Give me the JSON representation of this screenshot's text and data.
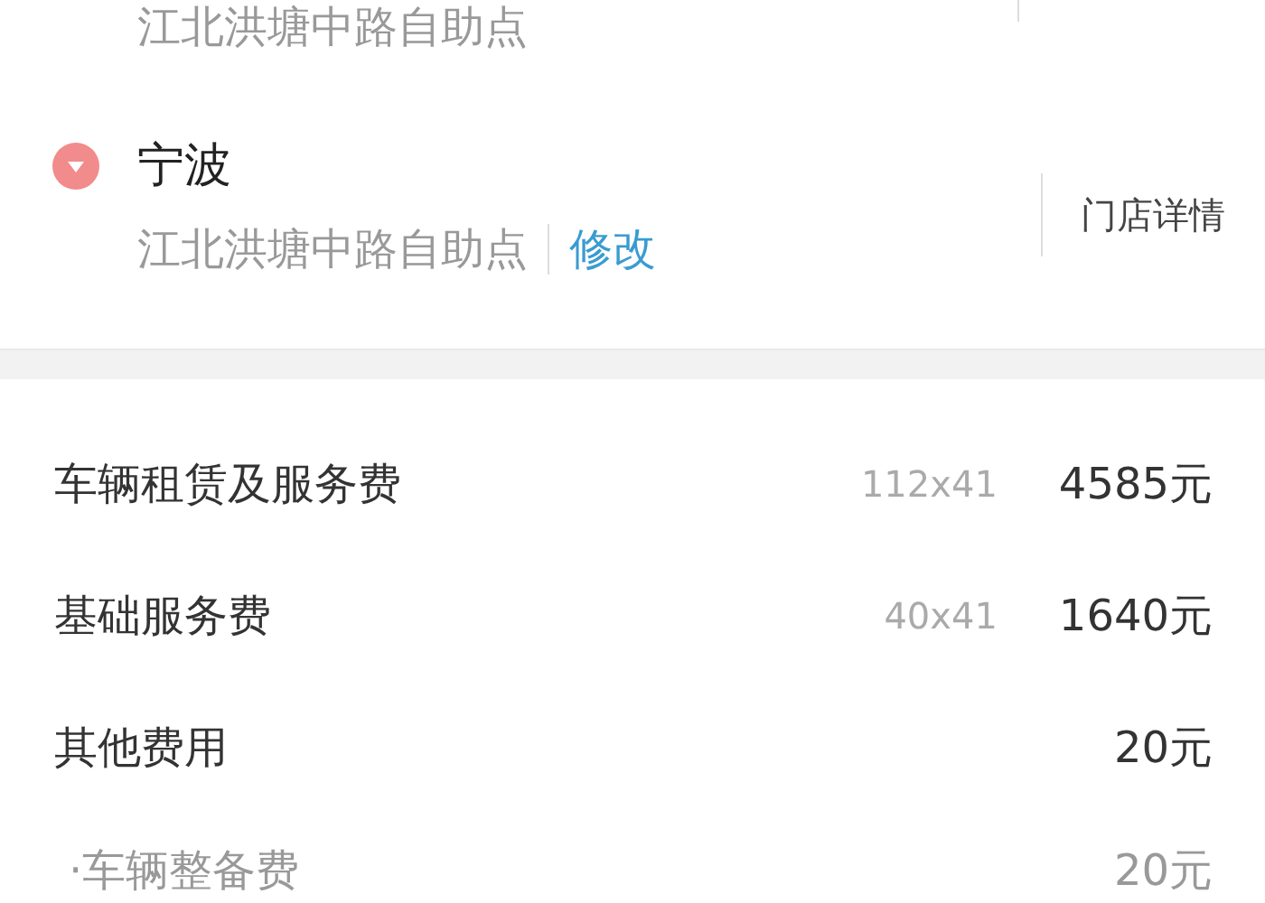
{
  "stores": [
    {
      "kind": "partial",
      "address": "江北洪塘中路自助点"
    },
    {
      "kind": "full",
      "name": "宁波",
      "address": "江北洪塘中路自助点",
      "edit_link": "修改",
      "detail_link": "门店详情"
    }
  ],
  "fees": [
    {
      "kind": "main",
      "label": "车辆租赁及服务费",
      "quantity": "112x41",
      "amount": "4585元"
    },
    {
      "kind": "main",
      "label": "基础服务费",
      "quantity": "40x41",
      "amount": "1640元"
    },
    {
      "kind": "main",
      "label": "其他费用",
      "amount": "20元"
    },
    {
      "kind": "sub",
      "label": "·车辆整备费",
      "amount": "20元"
    }
  ]
}
